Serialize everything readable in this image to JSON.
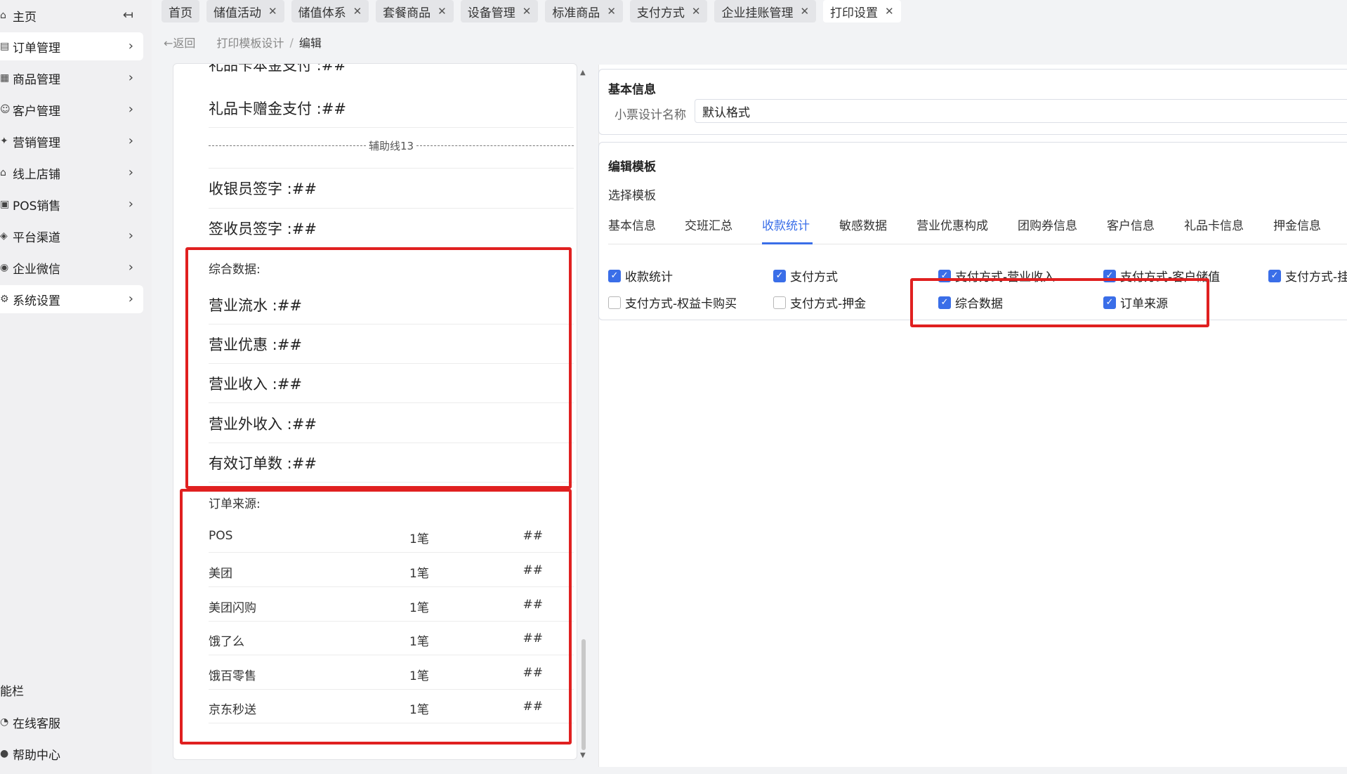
{
  "sidebar": {
    "items": [
      {
        "label": "主页",
        "icon": "home-icon",
        "glyph": "⌂"
      },
      {
        "label": "订单管理",
        "icon": "order-icon",
        "glyph": "▤"
      },
      {
        "label": "商品管理",
        "icon": "goods-icon",
        "glyph": "▦"
      },
      {
        "label": "客户管理",
        "icon": "customer-icon",
        "glyph": "☺"
      },
      {
        "label": "营销管理",
        "icon": "marketing-icon",
        "glyph": "✦"
      },
      {
        "label": "线上店铺",
        "icon": "store-icon",
        "glyph": "⌂"
      },
      {
        "label": "POS销售",
        "icon": "pos-icon",
        "glyph": "▣"
      },
      {
        "label": "平台渠道",
        "icon": "platform-icon",
        "glyph": "◈"
      },
      {
        "label": "企业微信",
        "icon": "wecom-icon",
        "glyph": "◉"
      },
      {
        "label": "系统设置",
        "icon": "settings-icon",
        "glyph": "⚙"
      }
    ],
    "collapse_glyph": "↤",
    "chevron": "›",
    "section_label": "能栏",
    "bottom": [
      {
        "label": "在线客服",
        "glyph": "◔"
      },
      {
        "label": "帮助中心",
        "glyph": "●"
      }
    ]
  },
  "tabs": [
    {
      "label": "首页",
      "closable": false
    },
    {
      "label": "储值活动",
      "closable": true
    },
    {
      "label": "储值体系",
      "closable": true
    },
    {
      "label": "套餐商品",
      "closable": true
    },
    {
      "label": "设备管理",
      "closable": true
    },
    {
      "label": "标准商品",
      "closable": true
    },
    {
      "label": "支付方式",
      "closable": true
    },
    {
      "label": "企业挂账管理",
      "closable": true
    },
    {
      "label": "打印设置",
      "closable": true,
      "active": true
    }
  ],
  "close_glyph": "✕",
  "breadcrumb": {
    "back": "←返回",
    "path1": "打印模板设计",
    "sep": "/",
    "current": "编辑"
  },
  "preview": {
    "cut_top": "礼品卡本金支付 :##",
    "giftcard_bonus": "礼品卡赠金支付 :##",
    "aux_line": "辅助线13",
    "cashier_sign": "收银员签字 :##",
    "receiver_sign": "签收员签字 :##",
    "summary_title": "综合数据:",
    "summary_rows": [
      "营业流水 :##",
      "营业优惠 :##",
      "营业收入 :##",
      "营业外收入 :##",
      "有效订单数 :##"
    ],
    "source_title": "订单来源:",
    "source_rows": [
      {
        "name": "POS",
        "count": "1笔",
        "amount": "##"
      },
      {
        "name": "美团",
        "count": "1笔",
        "amount": "##"
      },
      {
        "name": "美团闪购",
        "count": "1笔",
        "amount": "##"
      },
      {
        "name": "饿了么",
        "count": "1笔",
        "amount": "##"
      },
      {
        "name": "饿百零售",
        "count": "1笔",
        "amount": "##"
      },
      {
        "name": "京东秒送",
        "count": "1笔",
        "amount": "##"
      }
    ]
  },
  "basic_info": {
    "title": "基本信息",
    "name_label": "小票设计名称",
    "name_value": "默认格式"
  },
  "edit_template": {
    "title": "编辑模板",
    "select_label": "选择模板",
    "tabs": [
      "基本信息",
      "交班汇总",
      "收款统计",
      "敏感数据",
      "营业优惠构成",
      "团购券信息",
      "客户信息",
      "礼品卡信息",
      "押金信息"
    ],
    "active_tab": "收款统计",
    "checkboxes": [
      {
        "label": "收款统计",
        "checked": true
      },
      {
        "label": "支付方式",
        "checked": true
      },
      {
        "label": "支付方式-营业收入",
        "checked": true
      },
      {
        "label": "支付方式-客户储值",
        "checked": true
      },
      {
        "label": "支付方式-挂",
        "checked": true
      },
      {
        "label": "支付方式-权益卡购买",
        "checked": false
      },
      {
        "label": "支付方式-押金",
        "checked": false
      },
      {
        "label": "综合数据",
        "checked": true
      },
      {
        "label": "订单来源",
        "checked": true
      }
    ]
  },
  "colors": {
    "accent": "#3a6ee8",
    "highlight": "#e02020"
  }
}
